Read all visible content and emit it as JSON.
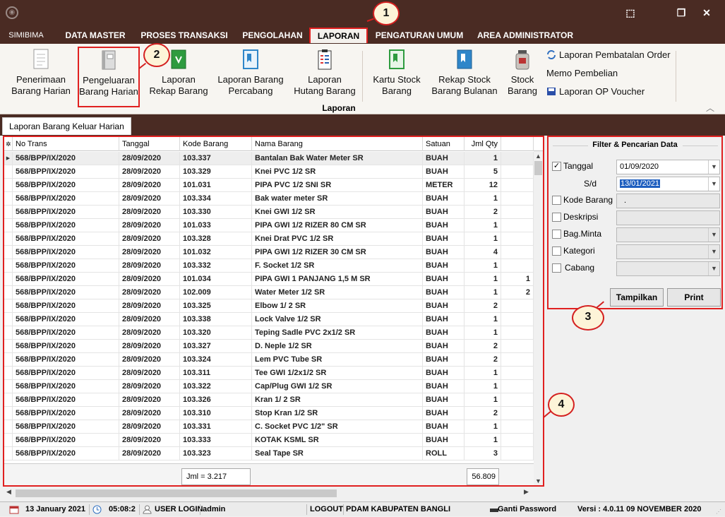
{
  "window": {
    "minimize_glyph": "⬚",
    "restore_glyph": "❐",
    "close_glyph": "✕"
  },
  "menu": {
    "app": "SIMIBIMA",
    "items": [
      "DATA MASTER",
      "PROSES TRANSAKSI",
      "PENGOLAHAN",
      "LAPORAN",
      "PENGATURAN UMUM",
      "AREA ADMINISTRATOR"
    ],
    "active": "LAPORAN"
  },
  "ribbon": {
    "buttons": [
      {
        "line1": "Penerimaan",
        "line2": "Barang Harian",
        "icon": "document-icon"
      },
      {
        "line1": "Pengeluaran",
        "line2": "Barang Harian",
        "icon": "book-icon"
      },
      {
        "line1": "Laporan",
        "line2": "Rekap Barang",
        "icon": "green-book-icon"
      },
      {
        "line1": "Laporan Barang",
        "line2": "Percabang",
        "icon": "blue-book-icon"
      },
      {
        "line1": "Laporan",
        "line2": "Hutang Barang",
        "icon": "clipboard-icon"
      },
      {
        "line1": "Kartu Stock",
        "line2": "Barang",
        "icon": "green-book-icon"
      },
      {
        "line1": "Rekap Stock",
        "line2": "Barang Bulanan",
        "icon": "blue-book-icon"
      },
      {
        "line1": "Stock",
        "line2": "Barang",
        "icon": "jar-icon"
      }
    ],
    "links": [
      "Laporan Pembatalan Order",
      "Memo Pembelian",
      "Laporan OP Voucher"
    ],
    "group_label": "Laporan",
    "collapse_glyph": "︿"
  },
  "doc_tab": "Laporan Barang Keluar Harian",
  "grid": {
    "columns": [
      "No Trans",
      "Tanggal",
      "Kode Barang",
      "Nama Barang",
      "Satuan",
      "Jml Qty"
    ],
    "rows": [
      [
        "568/BPP/IX/2020",
        "28/09/2020",
        "103.337",
        "Bantalan Bak Water Meter SR",
        "BUAH",
        "1",
        ""
      ],
      [
        "568/BPP/IX/2020",
        "28/09/2020",
        "103.329",
        "Knei PVC 1/2 SR",
        "BUAH",
        "5",
        ""
      ],
      [
        "568/BPP/IX/2020",
        "28/09/2020",
        "101.031",
        "PIPA PVC 1/2 SNI SR",
        "METER",
        "12",
        ""
      ],
      [
        "568/BPP/IX/2020",
        "28/09/2020",
        "103.334",
        "Bak water meter SR",
        "BUAH",
        "1",
        ""
      ],
      [
        "568/BPP/IX/2020",
        "28/09/2020",
        "103.330",
        "Knei GWI 1/2 SR",
        "BUAH",
        "2",
        ""
      ],
      [
        "568/BPP/IX/2020",
        "28/09/2020",
        "101.033",
        "PIPA GWI 1/2 RIZER 80 CM SR",
        "BUAH",
        "1",
        ""
      ],
      [
        "568/BPP/IX/2020",
        "28/09/2020",
        "103.328",
        "Knei Drat PVC 1/2 SR",
        "BUAH",
        "1",
        ""
      ],
      [
        "568/BPP/IX/2020",
        "28/09/2020",
        "101.032",
        "PIPA GWI 1/2 RIZER 30 CM SR",
        "BUAH",
        "4",
        ""
      ],
      [
        "568/BPP/IX/2020",
        "28/09/2020",
        "103.332",
        "F. Socket 1/2 SR",
        "BUAH",
        "1",
        ""
      ],
      [
        "568/BPP/IX/2020",
        "28/09/2020",
        "101.034",
        "PIPA GWI 1 PANJANG 1,5 M SR",
        "BUAH",
        "1",
        "1"
      ],
      [
        "568/BPP/IX/2020",
        "28/09/2020",
        "102.009",
        "Water Meter 1/2 SR",
        "BUAH",
        "1",
        "2"
      ],
      [
        "568/BPP/IX/2020",
        "28/09/2020",
        "103.325",
        "Elbow 1/ 2 SR",
        "BUAH",
        "2",
        ""
      ],
      [
        "568/BPP/IX/2020",
        "28/09/2020",
        "103.338",
        "Lock Valve 1/2 SR",
        "BUAH",
        "1",
        ""
      ],
      [
        "568/BPP/IX/2020",
        "28/09/2020",
        "103.320",
        "Teping Sadle PVC 2x1/2 SR",
        "BUAH",
        "1",
        ""
      ],
      [
        "568/BPP/IX/2020",
        "28/09/2020",
        "103.327",
        "D. Neple 1/2 SR",
        "BUAH",
        "2",
        ""
      ],
      [
        "568/BPP/IX/2020",
        "28/09/2020",
        "103.324",
        "Lem PVC Tube SR",
        "BUAH",
        "2",
        ""
      ],
      [
        "568/BPP/IX/2020",
        "28/09/2020",
        "103.311",
        "Tee GWI 1/2x1/2 SR",
        "BUAH",
        "1",
        ""
      ],
      [
        "568/BPP/IX/2020",
        "28/09/2020",
        "103.322",
        "Cap/Plug GWI 1/2 SR",
        "BUAH",
        "1",
        ""
      ],
      [
        "568/BPP/IX/2020",
        "28/09/2020",
        "103.326",
        "Kran 1/ 2 SR",
        "BUAH",
        "1",
        ""
      ],
      [
        "568/BPP/IX/2020",
        "28/09/2020",
        "103.310",
        "Stop Kran 1/2 SR",
        "BUAH",
        "2",
        ""
      ],
      [
        "568/BPP/IX/2020",
        "28/09/2020",
        "103.331",
        "C. Socket PVC 1/2\" SR",
        "BUAH",
        "1",
        ""
      ],
      [
        "568/BPP/IX/2020",
        "28/09/2020",
        "103.333",
        "KOTAK KSML SR",
        "BUAH",
        "1",
        ""
      ],
      [
        "568/BPP/IX/2020",
        "28/09/2020",
        "103.323",
        "Seal Tape SR",
        "ROLL",
        "3",
        ""
      ]
    ],
    "footer_count": "Jml = 3.217",
    "footer_total": "56.809"
  },
  "filter": {
    "title": "Filter & Pencarian Data",
    "tanggal_label": "Tanggal",
    "tanggal_checked": true,
    "tanggal_from": "01/09/2020",
    "sd_label": "S/d",
    "tanggal_to": "13/01/2021",
    "kode_label": "Kode Barang",
    "kode_value": ".",
    "deskripsi_label": "Deskripsi",
    "bag_label": "Bag.Minta",
    "kategori_label": "Kategori",
    "cabang_label": "Cabang",
    "tampilkan": "Tampilkan",
    "print": "Print"
  },
  "status": {
    "date": "13 January 2021",
    "time": "05:08:2",
    "user_label": "USER LOGIN",
    "user": "admin",
    "logout": "LOGOUT",
    "org": "PDAM KABUPATEN BANGLI",
    "ganti": "Ganti Password",
    "version": "Versi : 4.0.11  09 NOVEMBER 2020"
  },
  "callouts": [
    "1",
    "2",
    "3",
    "4"
  ],
  "colors": {
    "titlebar": "#4a2b23",
    "highlight": "#e02020",
    "callout_fill": "#fdf4d8",
    "selection": "#1f5fbf"
  }
}
